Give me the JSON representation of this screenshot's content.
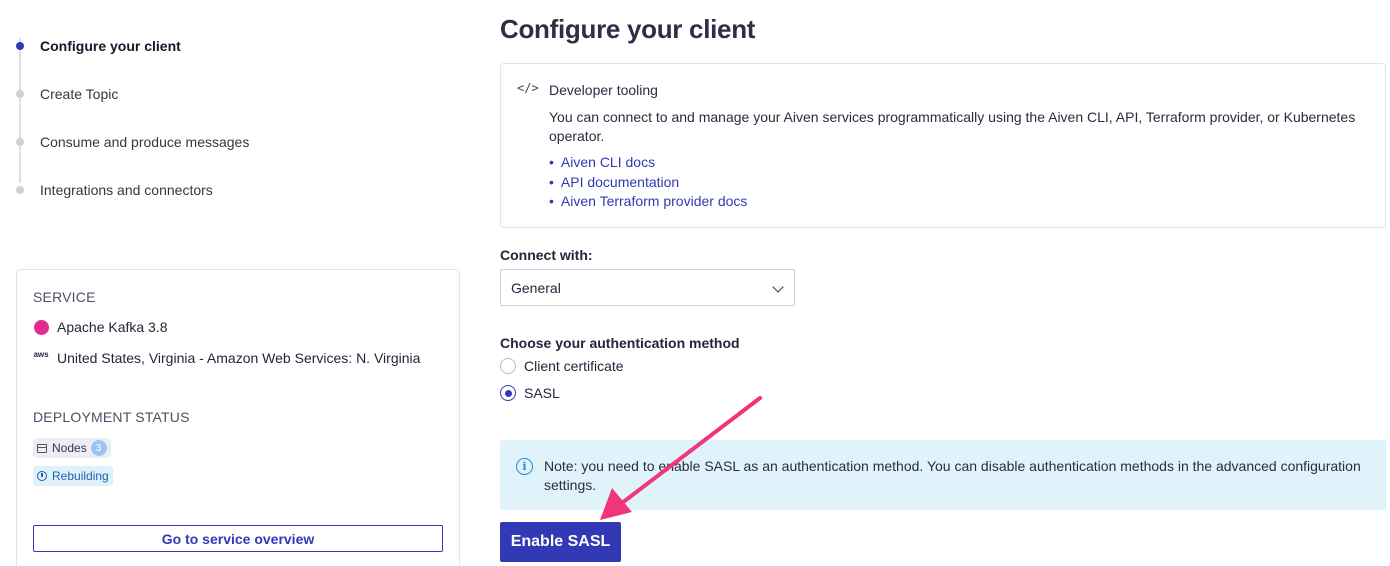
{
  "stepper": {
    "steps": [
      {
        "label": "Configure your client",
        "active": true
      },
      {
        "label": "Create Topic",
        "active": false
      },
      {
        "label": "Consume and produce messages",
        "active": false
      },
      {
        "label": "Integrations and connectors",
        "active": false
      }
    ]
  },
  "service": {
    "heading": "SERVICE",
    "name": "Apache Kafka 3.8",
    "cloud_icon_text": "aws",
    "region": "United States, Virginia - Amazon Web Services: N. Virginia",
    "deployment_heading": "DEPLOYMENT STATUS",
    "nodes_label": "Nodes",
    "nodes_count": "3",
    "status_label": "Rebuilding",
    "overview_button": "Go to service overview",
    "icons": {
      "service": "kafka-icon",
      "cloud": "aws-icon",
      "nodes": "server-icon",
      "status": "clock-icon"
    }
  },
  "main": {
    "title": "Configure your client",
    "dev_tooling": {
      "icon": "code-icon",
      "icon_glyph": "</>",
      "title": "Developer tooling",
      "text": "You can connect to and manage your Aiven services programmatically using the Aiven CLI, API, Terraform provider, or Kubernetes operator.",
      "links": [
        "Aiven CLI docs",
        "API documentation",
        "Aiven Terraform provider docs"
      ]
    },
    "connect_with": {
      "label": "Connect with:",
      "selected": "General"
    },
    "auth": {
      "label": "Choose your authentication method",
      "options": [
        {
          "label": "Client certificate",
          "selected": false
        },
        {
          "label": "SASL",
          "selected": true
        }
      ]
    },
    "note": {
      "icon": "info-icon",
      "icon_glyph": "i",
      "text": "Note: you need to enable SASL as an authentication method. You can disable authentication methods in the advanced configuration settings."
    },
    "enable_button": "Enable SASL"
  },
  "colors": {
    "primary": "#3239b4",
    "annotation_arrow": "#f0357a",
    "note_bg": "#e0f3fb",
    "kafka": "#e02d8f"
  }
}
